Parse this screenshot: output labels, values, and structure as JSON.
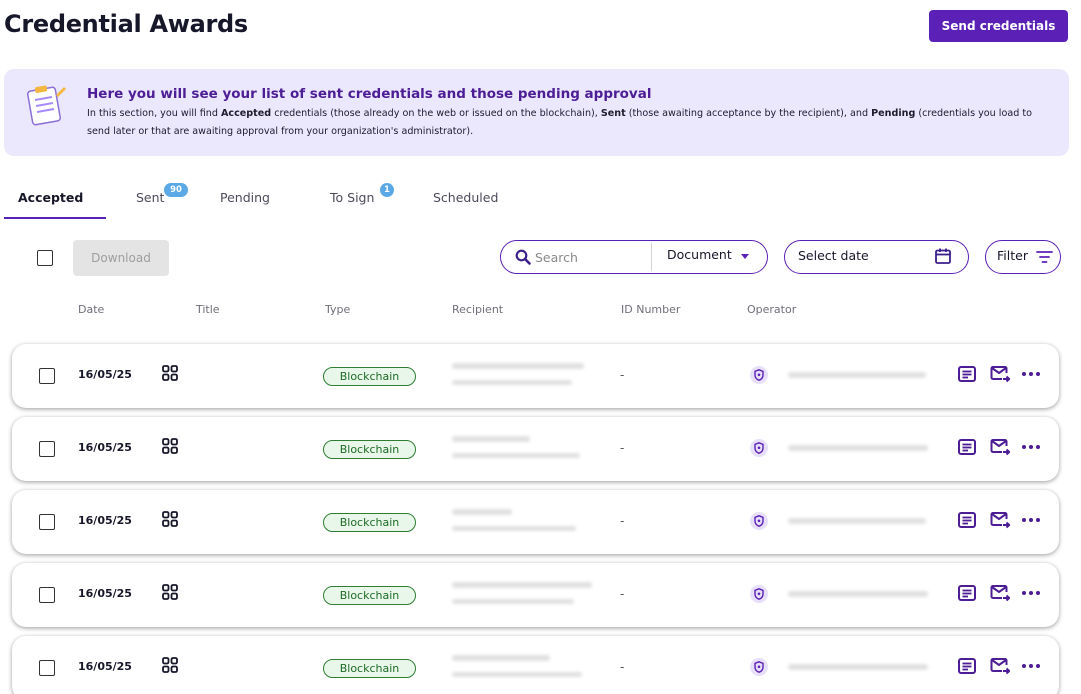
{
  "header": {
    "title": "Credential Awards",
    "send_button": "Send credentials"
  },
  "banner": {
    "heading": "Here you will see your list of sent credentials and those pending approval",
    "text_parts": [
      "In this section, you will find ",
      "Accepted",
      " credentials (those already on the web or issued on the blockchain), ",
      "Sent",
      " (those awaiting acceptance by the recipient), and ",
      "Pending",
      " (credentials you load to send later or that are awaiting approval from your organization's administrator)."
    ]
  },
  "tabs": [
    {
      "label": "Accepted",
      "active": true
    },
    {
      "label": "Sent",
      "badge": "90"
    },
    {
      "label": "Pending"
    },
    {
      "label": "To Sign",
      "badge": "1"
    },
    {
      "label": "Scheduled"
    }
  ],
  "toolbar": {
    "download_label": "Download",
    "search_placeholder": "Search",
    "document_select": "Document",
    "date_placeholder": "Select date",
    "filter_label": "Filter"
  },
  "columns": [
    "Date",
    "Title",
    "Type",
    "Recipient",
    "ID Number",
    "Operator"
  ],
  "rows": [
    {
      "date": "16/05/25",
      "type": "Blockchain",
      "id_number": "-"
    },
    {
      "date": "16/05/25",
      "type": "Blockchain",
      "id_number": "-"
    },
    {
      "date": "16/05/25",
      "type": "Blockchain",
      "id_number": "-"
    },
    {
      "date": "16/05/25",
      "type": "Blockchain",
      "id_number": "-"
    },
    {
      "date": "16/05/25",
      "type": "Blockchain",
      "id_number": "-"
    }
  ],
  "icons": {
    "title_cell": "grid-icon",
    "operator": "shield-icon",
    "actions": [
      "document-icon",
      "send-mail-icon",
      "more-icon"
    ],
    "search": "search-icon",
    "date": "calendar-icon",
    "filter": "filter-icon"
  },
  "colors": {
    "primary": "#5b21b6",
    "banner_bg": "#ebe7fd",
    "badge": "#5aa9e6",
    "blockchain_border": "#2e7d32",
    "blockchain_bg": "#e9f7ea"
  }
}
